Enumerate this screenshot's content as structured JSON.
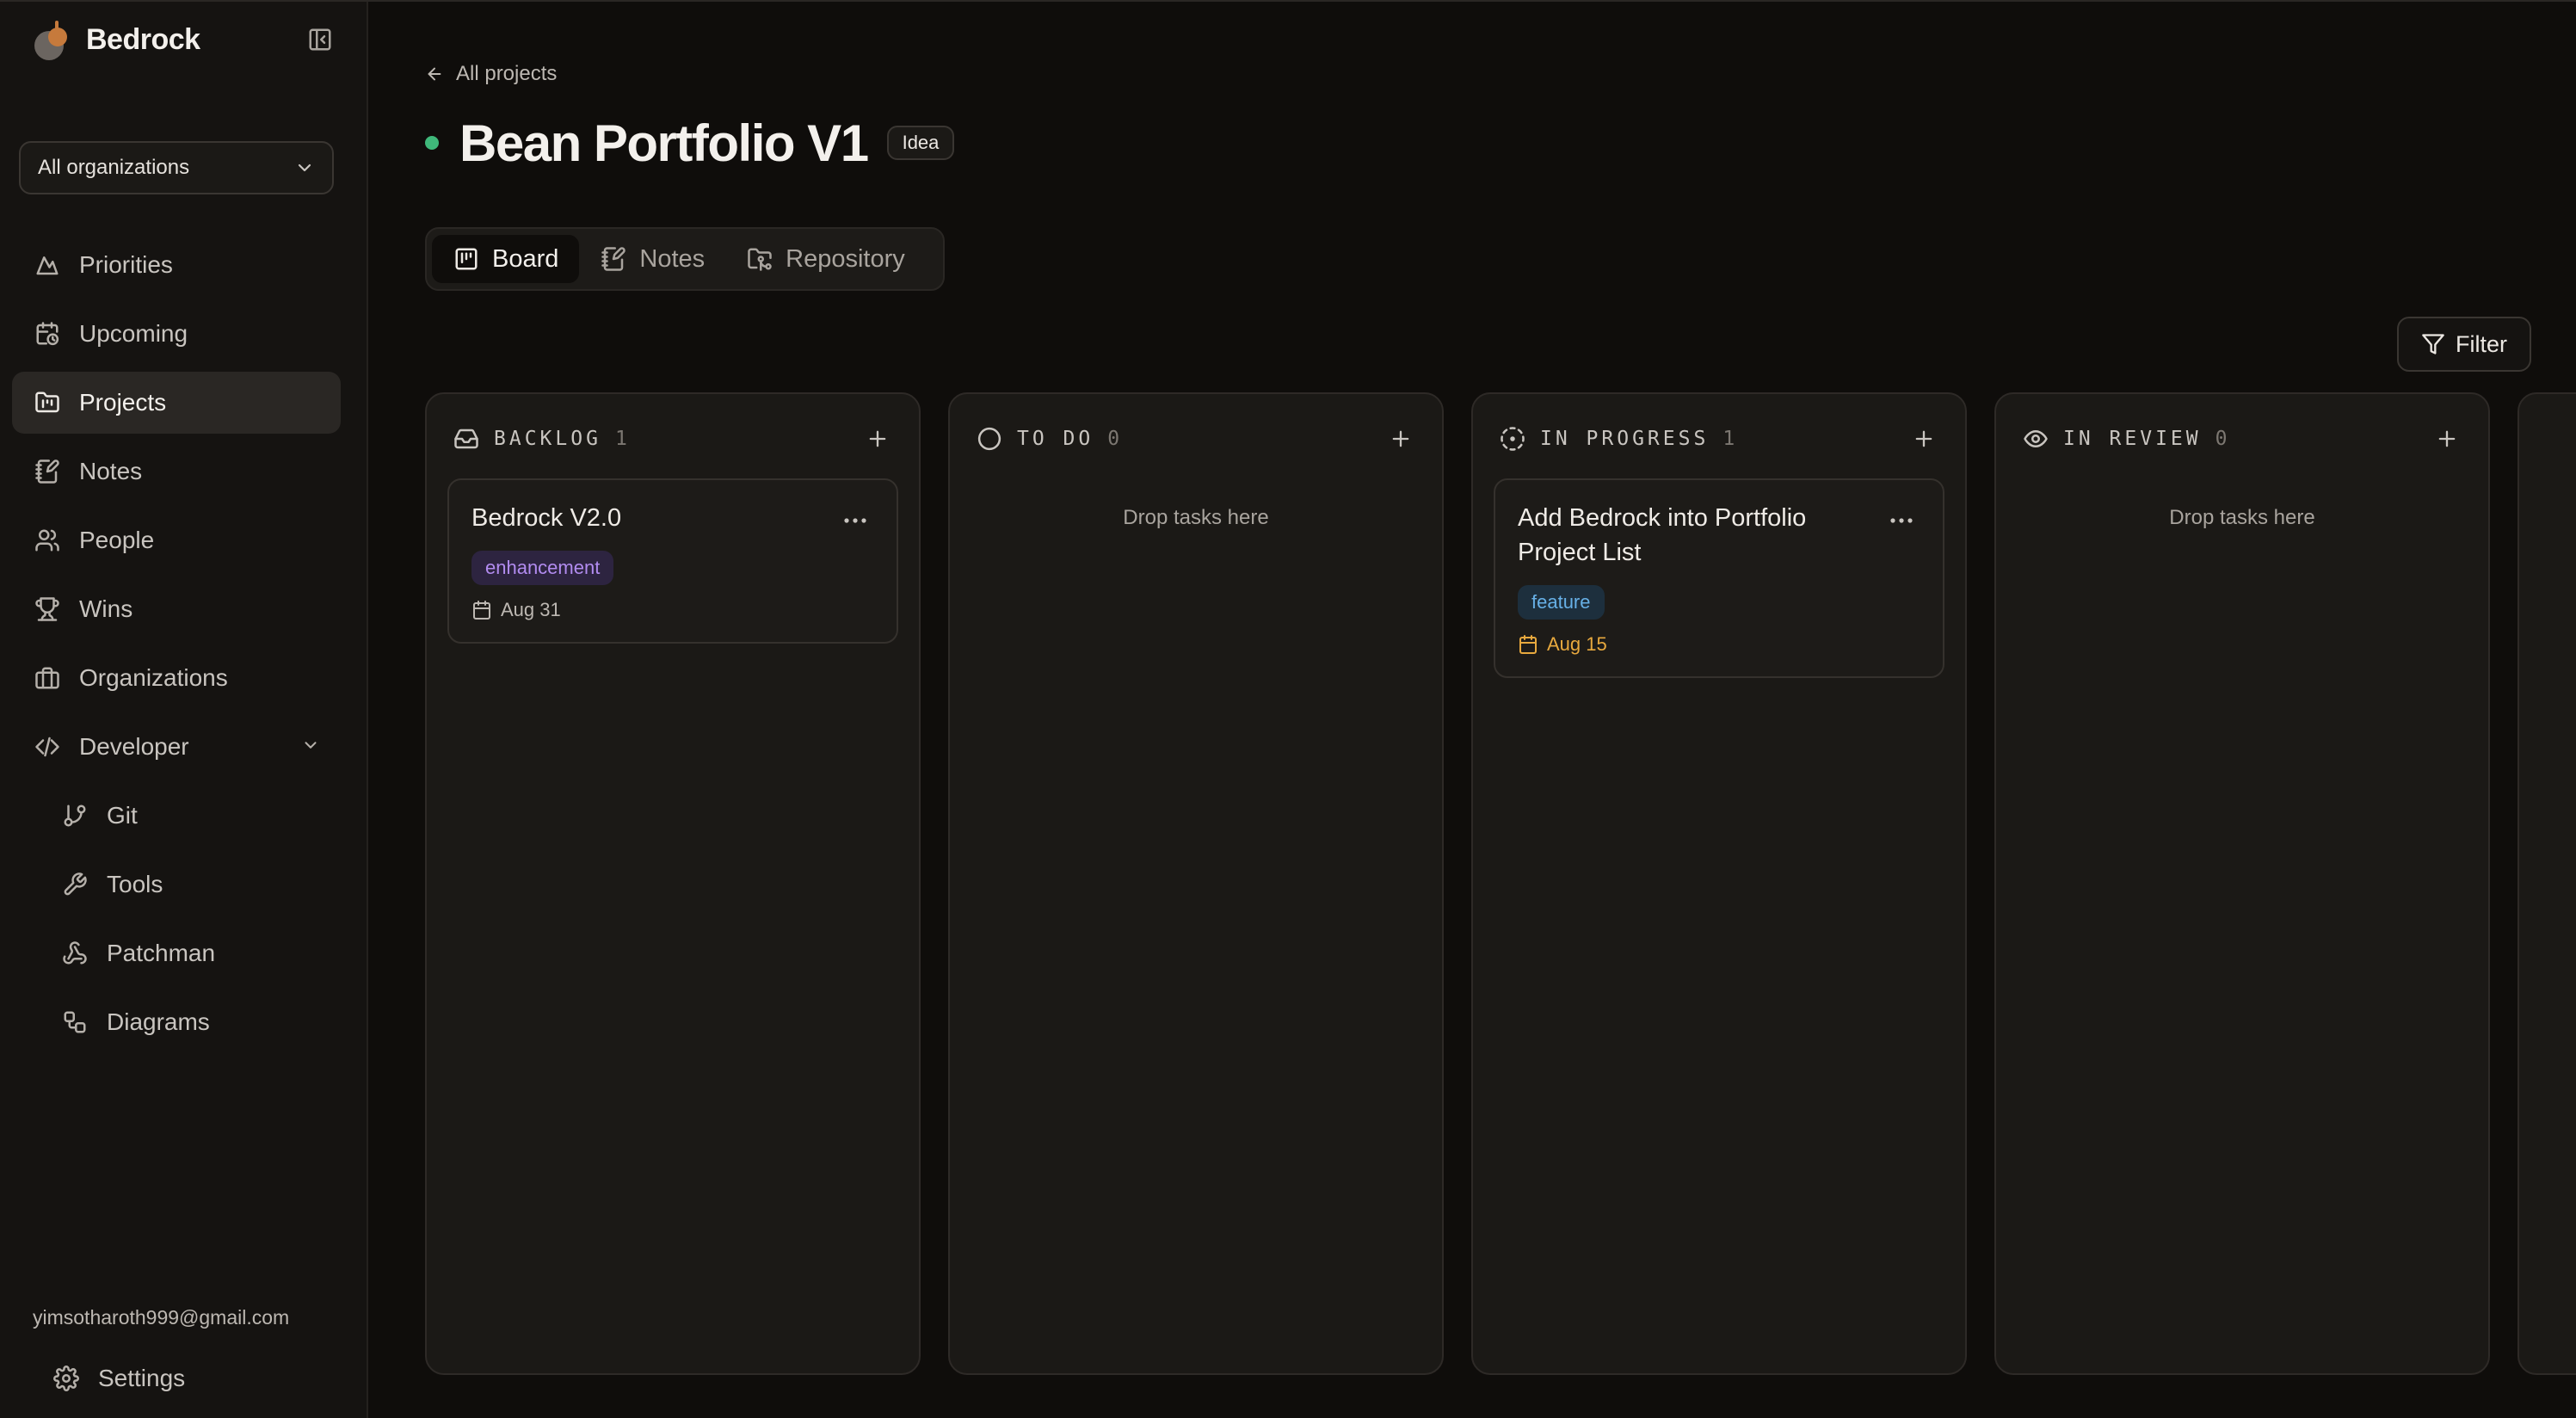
{
  "brand": {
    "name": "Bedrock"
  },
  "org_selector": {
    "value": "All organizations"
  },
  "nav": {
    "items": [
      {
        "label": "Priorities",
        "icon": "mountain-icon",
        "active": false
      },
      {
        "label": "Upcoming",
        "icon": "calendar-clock-icon",
        "active": false
      },
      {
        "label": "Projects",
        "icon": "folder-kanban-icon",
        "active": true
      },
      {
        "label": "Notes",
        "icon": "notebook-pen-icon",
        "active": false
      },
      {
        "label": "People",
        "icon": "users-icon",
        "active": false
      },
      {
        "label": "Wins",
        "icon": "trophy-icon",
        "active": false
      },
      {
        "label": "Organizations",
        "icon": "building-icon",
        "active": false
      },
      {
        "label": "Developer",
        "icon": "code-icon",
        "active": false
      }
    ],
    "developer_items": [
      {
        "label": "Git",
        "icon": "git-branch-icon"
      },
      {
        "label": "Tools",
        "icon": "wrench-icon"
      },
      {
        "label": "Patchman",
        "icon": "webhook-icon"
      },
      {
        "label": "Diagrams",
        "icon": "workflow-icon"
      }
    ]
  },
  "user": {
    "email": "yimsotharoth999@gmail.com"
  },
  "settings": {
    "label": "Settings"
  },
  "header": {
    "back_label": "All projects",
    "project_title": "Bean Portfolio V1",
    "status_badge": "Idea",
    "status_color": "#3fb87a"
  },
  "tabs": [
    {
      "label": "Board",
      "icon": "kanban-icon",
      "active": true
    },
    {
      "label": "Notes",
      "icon": "notebook-pen-icon",
      "active": false
    },
    {
      "label": "Repository",
      "icon": "folder-git-icon",
      "active": false
    }
  ],
  "filter": {
    "label": "Filter"
  },
  "columns": [
    {
      "title": "BACKLOG",
      "count": "1",
      "icon": "inbox-icon",
      "drop_hint": "",
      "cards": [
        {
          "title": "Bedrock V2.0",
          "tag": "enhancement",
          "due": "Aug 31"
        }
      ]
    },
    {
      "title": "TO DO",
      "count": "0",
      "icon": "circle-icon",
      "drop_hint": "Drop tasks here",
      "cards": []
    },
    {
      "title": "IN PROGRESS",
      "count": "1",
      "icon": "circle-dashed-icon",
      "drop_hint": "",
      "cards": [
        {
          "title": "Add Bedrock into Portfolio Project List",
          "tag": "feature",
          "due": "Aug 15"
        }
      ]
    },
    {
      "title": "IN REVIEW",
      "count": "0",
      "icon": "eye-icon",
      "drop_hint": "Drop tasks here",
      "cards": []
    }
  ],
  "colors": {
    "tag_enhancement": "#b28cf0",
    "tag_feature": "#67b0e6",
    "due_warning": "#e8a93e"
  }
}
